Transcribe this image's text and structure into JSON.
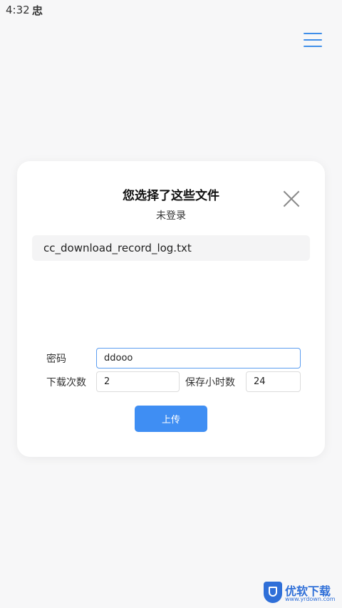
{
  "status_bar": {
    "time": "4:32",
    "notification_icon": "忠"
  },
  "header": {
    "menu_icon": "hamburger-menu-icon"
  },
  "dialog": {
    "title": "您选择了这些文件",
    "login_status": "未登录",
    "close_icon": "close-icon",
    "files": [
      "cc_download_record_log.txt"
    ],
    "password_label": "密码",
    "password_value": "ddooo",
    "download_count_label": "下载次数",
    "download_count_value": "2",
    "keep_hours_label": "保存小时数",
    "keep_hours_value": "24",
    "upload_label": "上传"
  },
  "watermark": {
    "text": "优软下载",
    "url": "www.yrdown.com"
  },
  "colors": {
    "accent": "#3f8ef3",
    "background": "#f7f7f8",
    "card": "#ffffff"
  }
}
